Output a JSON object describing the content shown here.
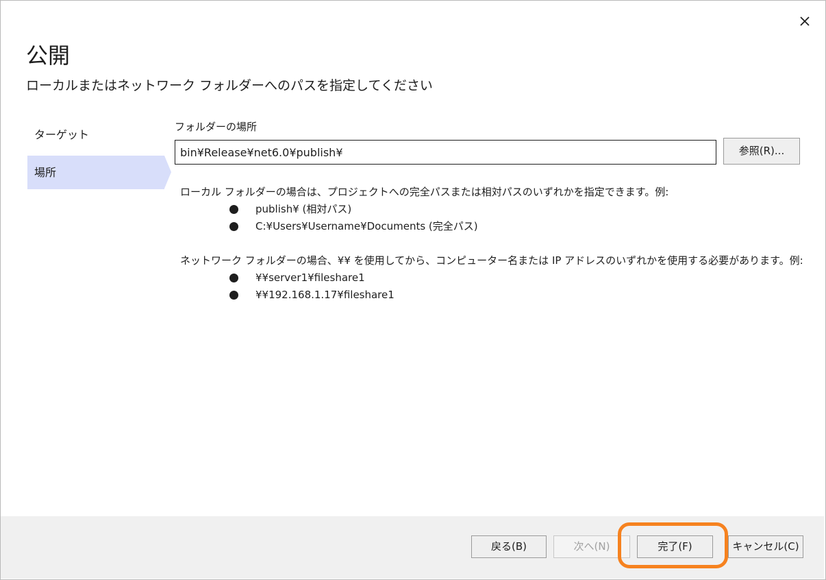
{
  "dialog": {
    "title": "公開",
    "subtitle": "ローカルまたはネットワーク フォルダーへのパスを指定してください"
  },
  "sidebar": {
    "items": [
      {
        "label": "ターゲット",
        "selected": false
      },
      {
        "label": "場所",
        "selected": true
      }
    ]
  },
  "folder": {
    "label": "フォルダーの場所",
    "value": "bin¥Release¥net6.0¥publish¥",
    "browse_label": "参照(R)..."
  },
  "help": {
    "local_intro": "ローカル フォルダーの場合は、プロジェクトへの完全パスまたは相対パスのいずれかを指定できます。例:",
    "local_examples": [
      "publish¥ (相対パス)",
      "C:¥Users¥Username¥Documents (完全パス)"
    ],
    "network_intro": "ネットワーク フォルダーの場合、¥¥ を使用してから、コンピューター名または IP アドレスのいずれかを使用する必要があります。例:",
    "network_examples": [
      "¥¥server1¥fileshare1",
      "¥¥192.168.1.17¥fileshare1"
    ]
  },
  "footer": {
    "back_label": "戻る(B)",
    "next_label": "次へ(N)",
    "finish_label": "完了(F)",
    "cancel_label": "キャンセル(C)"
  },
  "colors": {
    "selected_sidebar": "#d8defa",
    "highlight": "#f6821f",
    "footer_bg": "#f0f0f0"
  }
}
